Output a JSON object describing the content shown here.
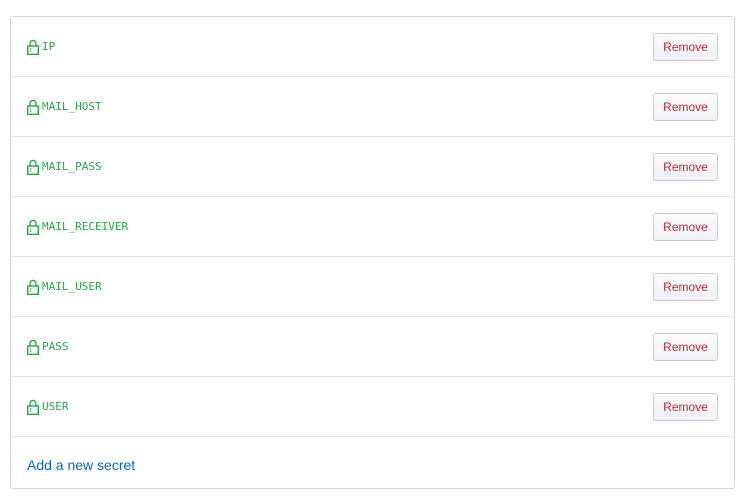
{
  "secrets": {
    "items": [
      {
        "name": "IP",
        "remove_label": "Remove"
      },
      {
        "name": "MAIL_HOST",
        "remove_label": "Remove"
      },
      {
        "name": "MAIL_PASS",
        "remove_label": "Remove"
      },
      {
        "name": "MAIL_RECEIVER",
        "remove_label": "Remove"
      },
      {
        "name": "MAIL_USER",
        "remove_label": "Remove"
      },
      {
        "name": "PASS",
        "remove_label": "Remove"
      },
      {
        "name": "USER",
        "remove_label": "Remove"
      }
    ],
    "icon": "lock-icon",
    "add_label": "Add a new secret"
  },
  "colors": {
    "secret_name": "#28a745",
    "remove_text": "#cb2431",
    "link": "#0366d6",
    "border": "#d1d5da"
  }
}
